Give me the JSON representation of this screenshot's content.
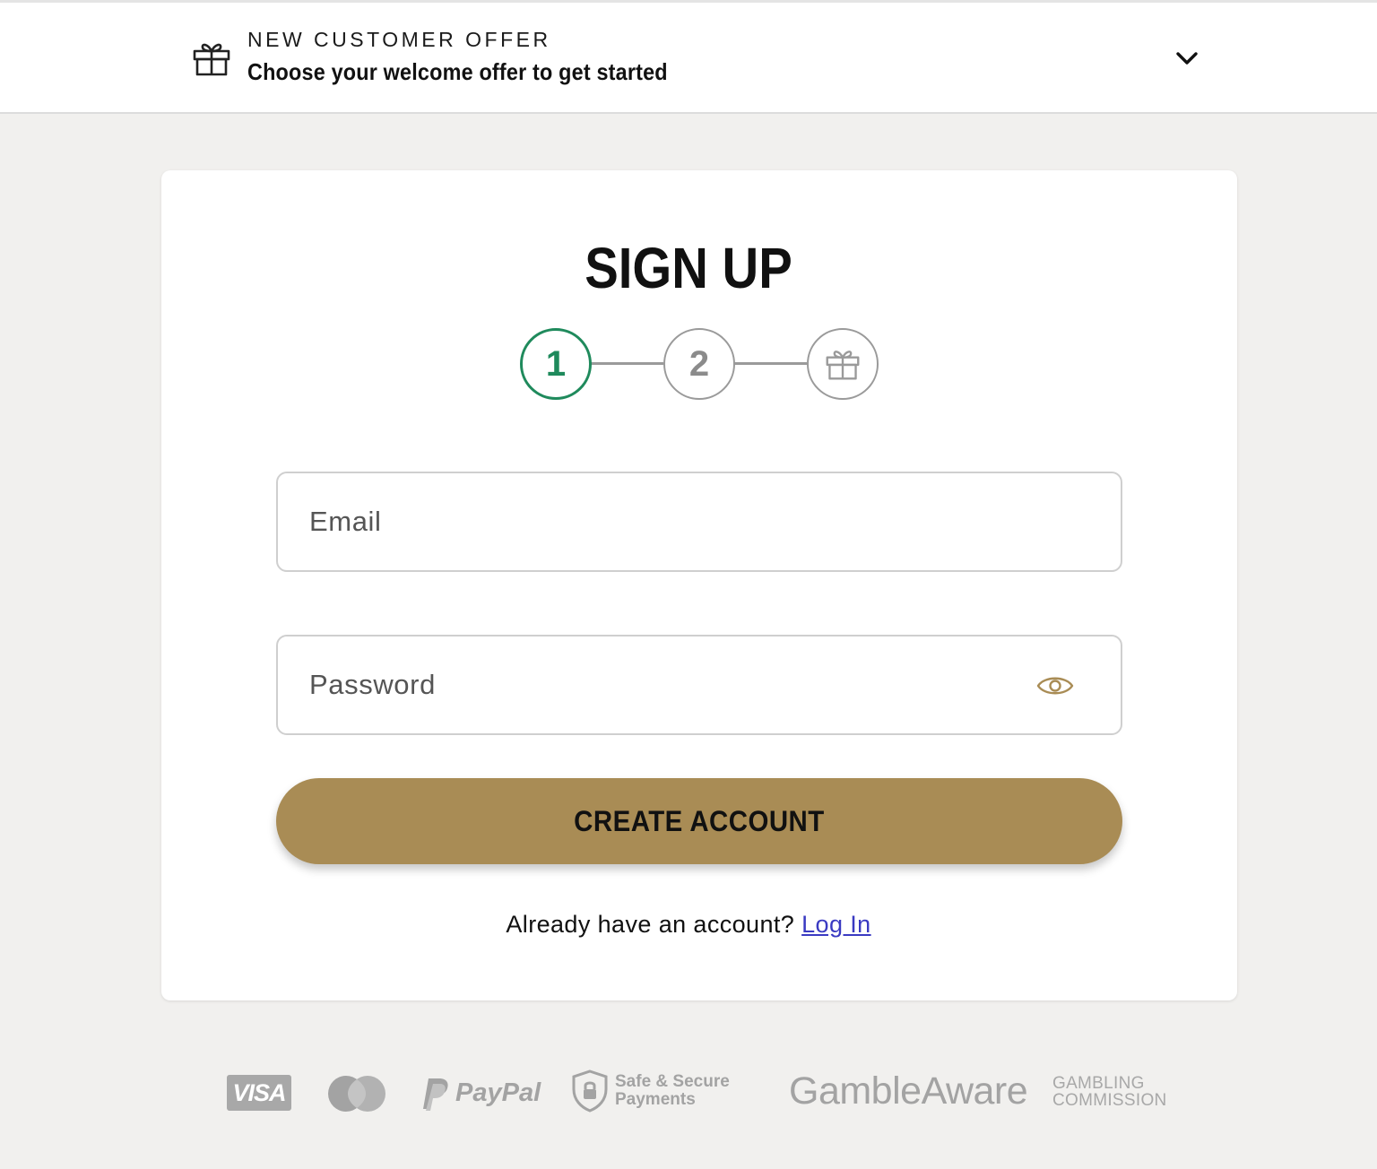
{
  "offer": {
    "kicker": "NEW CUSTOMER OFFER",
    "title": "Choose your welcome offer to get started",
    "gift_icon": "gift-icon",
    "toggle_icon": "chevron-down-icon"
  },
  "signup": {
    "title": "SIGN UP",
    "steps": [
      "1",
      "2",
      "gift-icon"
    ],
    "active_step": 1,
    "email_placeholder": "Email",
    "password_placeholder": "Password",
    "password_toggle_icon": "eye-icon",
    "create_button": "CREATE ACCOUNT",
    "login_prompt": "Already have an account?",
    "login_link": "Log In"
  },
  "footer": {
    "visa": "VISA",
    "paypal": "PayPal",
    "safe_line1": "Safe & Secure",
    "safe_line2": "Payments",
    "gambleaware": "GambleAware",
    "commission_line1": "GAMBLING",
    "commission_line2": "COMMISSION"
  },
  "colors": {
    "accent_green": "#1f8a5c",
    "button_gold": "#a98c55",
    "link_blue": "#3a3ac2",
    "page_bg": "#f1f0ee"
  }
}
